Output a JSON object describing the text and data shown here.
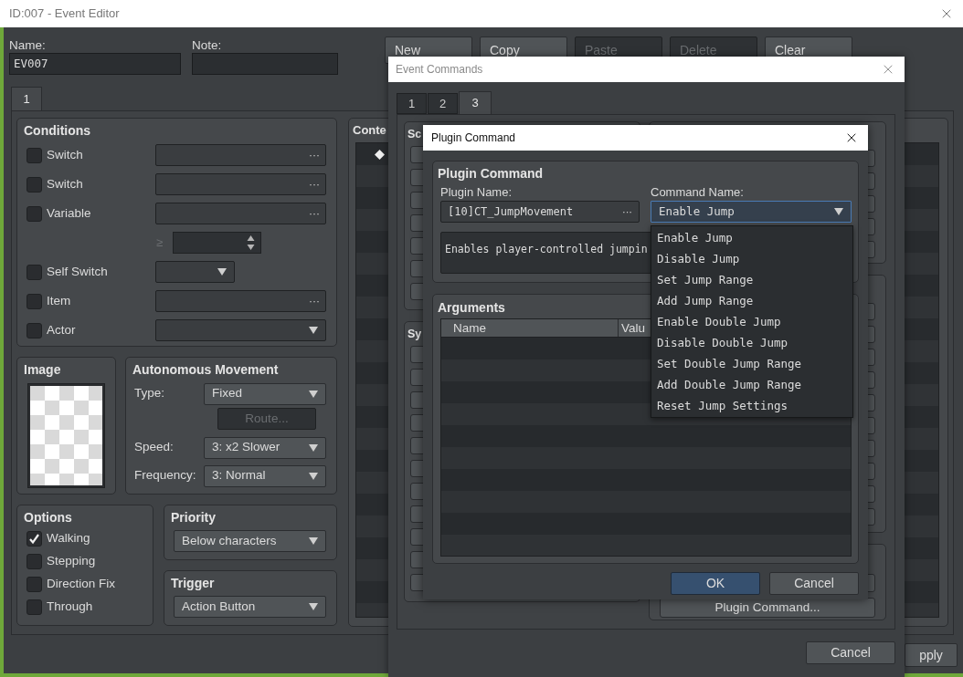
{
  "window": {
    "title": "ID:007 - Event Editor"
  },
  "name": {
    "label": "Name:",
    "value": "EV007"
  },
  "note": {
    "label": "Note:"
  },
  "page_buttons": [
    {
      "label": "New",
      "disabled": false
    },
    {
      "label": "Copy",
      "disabled": false
    },
    {
      "label": "Paste",
      "disabled": true
    },
    {
      "label": "Delete",
      "disabled": true
    },
    {
      "label": "Clear",
      "disabled": false
    }
  ],
  "page_tabs": [
    {
      "label": "1",
      "selected": true
    }
  ],
  "conditions": {
    "title": "Conditions",
    "rows": [
      {
        "kind": "picker",
        "label": "Switch",
        "checked": false,
        "dots": "···"
      },
      {
        "kind": "picker",
        "label": "Switch",
        "checked": false,
        "dots": "···"
      },
      {
        "kind": "picker",
        "label": "Variable",
        "checked": false,
        "dots": "···"
      },
      {
        "kind": "compare",
        "sign": "≥"
      },
      {
        "kind": "short_select",
        "label": "Self Switch",
        "checked": false
      },
      {
        "kind": "picker",
        "label": "Item",
        "checked": false,
        "dots": "···"
      },
      {
        "kind": "select",
        "label": "Actor",
        "checked": false
      }
    ]
  },
  "image": {
    "title": "Image"
  },
  "movement": {
    "title": "Autonomous Movement",
    "type": {
      "label": "Type:",
      "value": "Fixed"
    },
    "route": {
      "label": "Route...",
      "disabled": true
    },
    "speed": {
      "label": "Speed:",
      "value": "3: x2 Slower"
    },
    "frequency": {
      "label": "Frequency:",
      "value": "3: Normal"
    }
  },
  "options": {
    "title": "Options",
    "items": [
      {
        "label": "Walking",
        "checked": true
      },
      {
        "label": "Stepping",
        "checked": false
      },
      {
        "label": "Direction Fix",
        "checked": false
      },
      {
        "label": "Through",
        "checked": false
      }
    ]
  },
  "priority": {
    "title": "Priority",
    "value": "Below characters"
  },
  "trigger": {
    "title": "Trigger",
    "value": "Action Button"
  },
  "contents": {
    "title": "Conte"
  },
  "apply_button": {
    "label": "pply"
  },
  "event_commands": {
    "title": "Event Commands",
    "tabs": [
      {
        "label": "1",
        "selected": false
      },
      {
        "label": "2",
        "selected": false
      },
      {
        "label": "3",
        "selected": true
      }
    ],
    "groups": [
      {
        "title": "Sc"
      },
      {
        "title": "Sy"
      }
    ],
    "plugin_button": {
      "label": "Plugin Command..."
    },
    "cancel_button": {
      "label": "Cancel"
    }
  },
  "plugin_dialog": {
    "title": "Plugin Command",
    "group_title": "Plugin Command",
    "plugin_name": {
      "label": "Plugin Name:",
      "value": "[10]CT_JumpMovement",
      "dots": "···"
    },
    "command_name": {
      "label": "Command Name:",
      "value": "Enable Jump",
      "expanded": true,
      "options": [
        "Enable Jump",
        "Disable Jump",
        "Set Jump Range",
        "Add Jump Range",
        "Enable Double Jump",
        "Disable Double Jump",
        "Set Double Jump Range",
        "Add Double Jump Range",
        "Reset Jump Settings"
      ]
    },
    "description": "Enables player-controlled jumpin",
    "arguments": {
      "title": "Arguments",
      "columns": [
        "Name",
        "Valu"
      ]
    },
    "buttons": [
      {
        "label": "OK",
        "kind": "primary"
      },
      {
        "label": "Cancel",
        "kind": "normal"
      }
    ]
  }
}
